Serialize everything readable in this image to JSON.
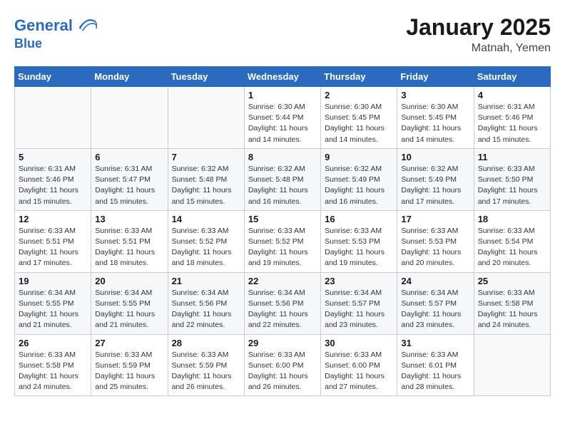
{
  "header": {
    "logo_line1": "General",
    "logo_line2": "Blue",
    "month": "January 2025",
    "location": "Matnah, Yemen"
  },
  "columns": [
    "Sunday",
    "Monday",
    "Tuesday",
    "Wednesday",
    "Thursday",
    "Friday",
    "Saturday"
  ],
  "weeks": [
    [
      {
        "day": "",
        "empty": true
      },
      {
        "day": "",
        "empty": true
      },
      {
        "day": "",
        "empty": true
      },
      {
        "day": "1",
        "sunrise": "6:30 AM",
        "sunset": "5:44 PM",
        "daylight": "11 hours and 14 minutes."
      },
      {
        "day": "2",
        "sunrise": "6:30 AM",
        "sunset": "5:45 PM",
        "daylight": "11 hours and 14 minutes."
      },
      {
        "day": "3",
        "sunrise": "6:30 AM",
        "sunset": "5:45 PM",
        "daylight": "11 hours and 14 minutes."
      },
      {
        "day": "4",
        "sunrise": "6:31 AM",
        "sunset": "5:46 PM",
        "daylight": "11 hours and 15 minutes."
      }
    ],
    [
      {
        "day": "5",
        "sunrise": "6:31 AM",
        "sunset": "5:46 PM",
        "daylight": "11 hours and 15 minutes."
      },
      {
        "day": "6",
        "sunrise": "6:31 AM",
        "sunset": "5:47 PM",
        "daylight": "11 hours and 15 minutes."
      },
      {
        "day": "7",
        "sunrise": "6:32 AM",
        "sunset": "5:48 PM",
        "daylight": "11 hours and 15 minutes."
      },
      {
        "day": "8",
        "sunrise": "6:32 AM",
        "sunset": "5:48 PM",
        "daylight": "11 hours and 16 minutes."
      },
      {
        "day": "9",
        "sunrise": "6:32 AM",
        "sunset": "5:49 PM",
        "daylight": "11 hours and 16 minutes."
      },
      {
        "day": "10",
        "sunrise": "6:32 AM",
        "sunset": "5:49 PM",
        "daylight": "11 hours and 17 minutes."
      },
      {
        "day": "11",
        "sunrise": "6:33 AM",
        "sunset": "5:50 PM",
        "daylight": "11 hours and 17 minutes."
      }
    ],
    [
      {
        "day": "12",
        "sunrise": "6:33 AM",
        "sunset": "5:51 PM",
        "daylight": "11 hours and 17 minutes."
      },
      {
        "day": "13",
        "sunrise": "6:33 AM",
        "sunset": "5:51 PM",
        "daylight": "11 hours and 18 minutes."
      },
      {
        "day": "14",
        "sunrise": "6:33 AM",
        "sunset": "5:52 PM",
        "daylight": "11 hours and 18 minutes."
      },
      {
        "day": "15",
        "sunrise": "6:33 AM",
        "sunset": "5:52 PM",
        "daylight": "11 hours and 19 minutes."
      },
      {
        "day": "16",
        "sunrise": "6:33 AM",
        "sunset": "5:53 PM",
        "daylight": "11 hours and 19 minutes."
      },
      {
        "day": "17",
        "sunrise": "6:33 AM",
        "sunset": "5:53 PM",
        "daylight": "11 hours and 20 minutes."
      },
      {
        "day": "18",
        "sunrise": "6:33 AM",
        "sunset": "5:54 PM",
        "daylight": "11 hours and 20 minutes."
      }
    ],
    [
      {
        "day": "19",
        "sunrise": "6:34 AM",
        "sunset": "5:55 PM",
        "daylight": "11 hours and 21 minutes."
      },
      {
        "day": "20",
        "sunrise": "6:34 AM",
        "sunset": "5:55 PM",
        "daylight": "11 hours and 21 minutes."
      },
      {
        "day": "21",
        "sunrise": "6:34 AM",
        "sunset": "5:56 PM",
        "daylight": "11 hours and 22 minutes."
      },
      {
        "day": "22",
        "sunrise": "6:34 AM",
        "sunset": "5:56 PM",
        "daylight": "11 hours and 22 minutes."
      },
      {
        "day": "23",
        "sunrise": "6:34 AM",
        "sunset": "5:57 PM",
        "daylight": "11 hours and 23 minutes."
      },
      {
        "day": "24",
        "sunrise": "6:34 AM",
        "sunset": "5:57 PM",
        "daylight": "11 hours and 23 minutes."
      },
      {
        "day": "25",
        "sunrise": "6:33 AM",
        "sunset": "5:58 PM",
        "daylight": "11 hours and 24 minutes."
      }
    ],
    [
      {
        "day": "26",
        "sunrise": "6:33 AM",
        "sunset": "5:58 PM",
        "daylight": "11 hours and 24 minutes."
      },
      {
        "day": "27",
        "sunrise": "6:33 AM",
        "sunset": "5:59 PM",
        "daylight": "11 hours and 25 minutes."
      },
      {
        "day": "28",
        "sunrise": "6:33 AM",
        "sunset": "5:59 PM",
        "daylight": "11 hours and 26 minutes."
      },
      {
        "day": "29",
        "sunrise": "6:33 AM",
        "sunset": "6:00 PM",
        "daylight": "11 hours and 26 minutes."
      },
      {
        "day": "30",
        "sunrise": "6:33 AM",
        "sunset": "6:00 PM",
        "daylight": "11 hours and 27 minutes."
      },
      {
        "day": "31",
        "sunrise": "6:33 AM",
        "sunset": "6:01 PM",
        "daylight": "11 hours and 28 minutes."
      },
      {
        "day": "",
        "empty": true
      }
    ]
  ],
  "labels": {
    "sunrise_prefix": "Sunrise: ",
    "sunset_prefix": "Sunset: ",
    "daylight_prefix": "Daylight: "
  }
}
